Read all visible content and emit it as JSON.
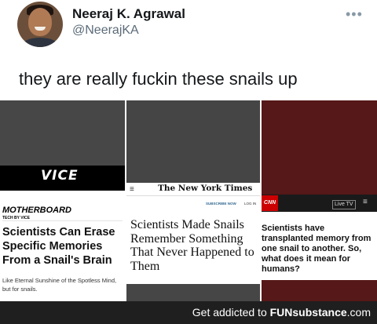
{
  "tweet": {
    "display_name": "Neeraj K. Agrawal",
    "handle": "@NeerajKA",
    "more_glyph": "•••",
    "text": "they are really fuckin these snails up"
  },
  "articles": [
    {
      "logo": "VICE",
      "section": "MOTHERBOARD",
      "subsection": "TECH BY VICE",
      "headline": "Scientists Can Erase Specific Memories From a Snail's Brain",
      "dek": "Like Eternal Sunshine of the Spotless Mind, but for snails."
    },
    {
      "menu_glyph": "≡",
      "logo": "The New York Times",
      "subscribe": "SUBSCRIBE NOW",
      "login": "LOG IN",
      "headline": "Scientists Made Snails Remember Something That Never Happened to Them"
    },
    {
      "logo": "CNN",
      "live": "Live TV",
      "menu_glyph": "≡",
      "headline": "Scientists have transplanted memory from one snail to another. So, what does it mean for humans?"
    }
  ],
  "footer": {
    "prefix": "Get addicted to ",
    "brand": "FUNsubstance",
    "suffix": ".com"
  }
}
